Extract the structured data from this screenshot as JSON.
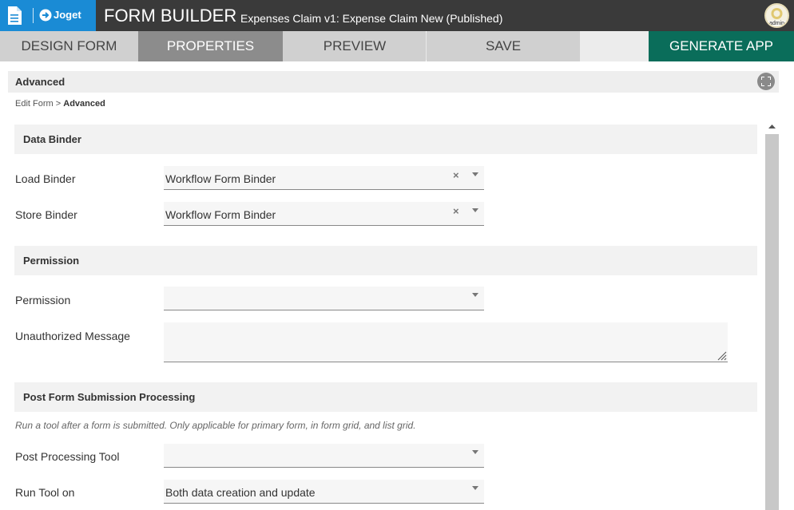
{
  "header": {
    "brand": "Joget",
    "title": "FORM BUILDER",
    "subtitle": "Expenses Claim v1: Expense Claim New (Published)",
    "user": "admin"
  },
  "steps": [
    {
      "label": "DESIGN FORM"
    },
    {
      "label": "PROPERTIES"
    },
    {
      "label": "PREVIEW"
    },
    {
      "label": "SAVE"
    },
    {
      "label": "GENERATE APP"
    }
  ],
  "panel": {
    "title": "Advanced"
  },
  "breadcrumb": {
    "parent": "Edit Form",
    "separator": ">",
    "current": "Advanced"
  },
  "sections": {
    "data_binder": {
      "title": "Data Binder",
      "load_binder": {
        "label": "Load Binder",
        "value": "Workflow Form Binder"
      },
      "store_binder": {
        "label": "Store Binder",
        "value": "Workflow Form Binder"
      }
    },
    "permission": {
      "title": "Permission",
      "permission": {
        "label": "Permission",
        "value": ""
      },
      "unauthorized_message": {
        "label": "Unauthorized Message",
        "value": ""
      }
    },
    "post_processing": {
      "title": "Post Form Submission Processing",
      "hint": "Run a tool after a form is submitted. Only applicable for primary form, in form grid, and list grid.",
      "post_processing_tool": {
        "label": "Post Processing Tool",
        "value": ""
      },
      "run_tool_on": {
        "label": "Run Tool on",
        "value": "Both data creation and update"
      }
    }
  },
  "colors": {
    "brand_blue": "#1a8bd5",
    "header_dark": "#3a3a3a",
    "active_step": "#8c8c8c",
    "generate_green": "#0a6d5a"
  },
  "icons": {
    "clear": "×"
  }
}
